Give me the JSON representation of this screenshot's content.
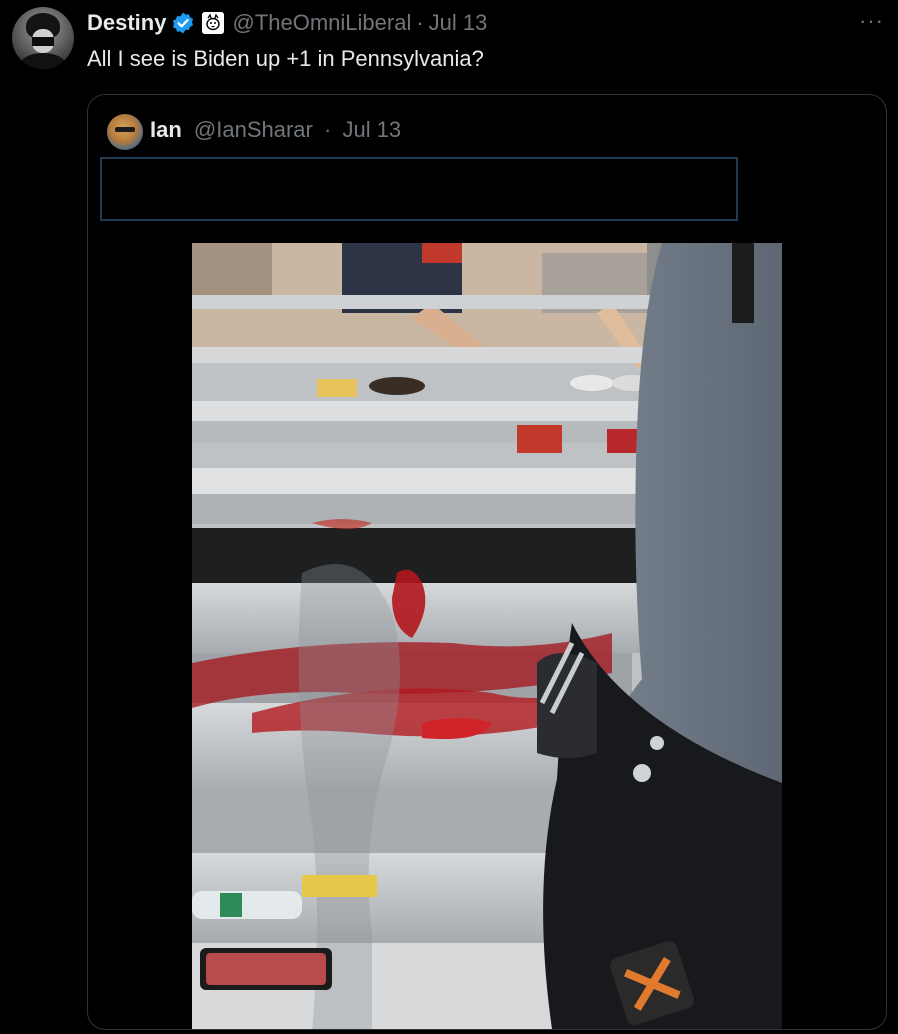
{
  "tweet": {
    "author_name": "Destiny",
    "author_handle": "@TheOmniLiberal",
    "separator": "·",
    "date": "Jul 13",
    "text": "All I see is Biden up +1 in Pennsylvania?",
    "more_label": "···",
    "avatar_icon": "user-avatar",
    "verified_icon": "verified-badge-icon",
    "affiliate_icon": "affiliate-badge-icon"
  },
  "quoted": {
    "author_name": "Ian",
    "author_handle": "@IanSharar",
    "separator": "·",
    "date": "Jul 13",
    "media_alt": "photo"
  },
  "colors": {
    "background": "#000000",
    "primary_text": "#e7e9ea",
    "secondary_text": "#71767b",
    "border": "#2f3336",
    "verified": "#1d9bf0",
    "redaction_border": "#1f3a52"
  }
}
